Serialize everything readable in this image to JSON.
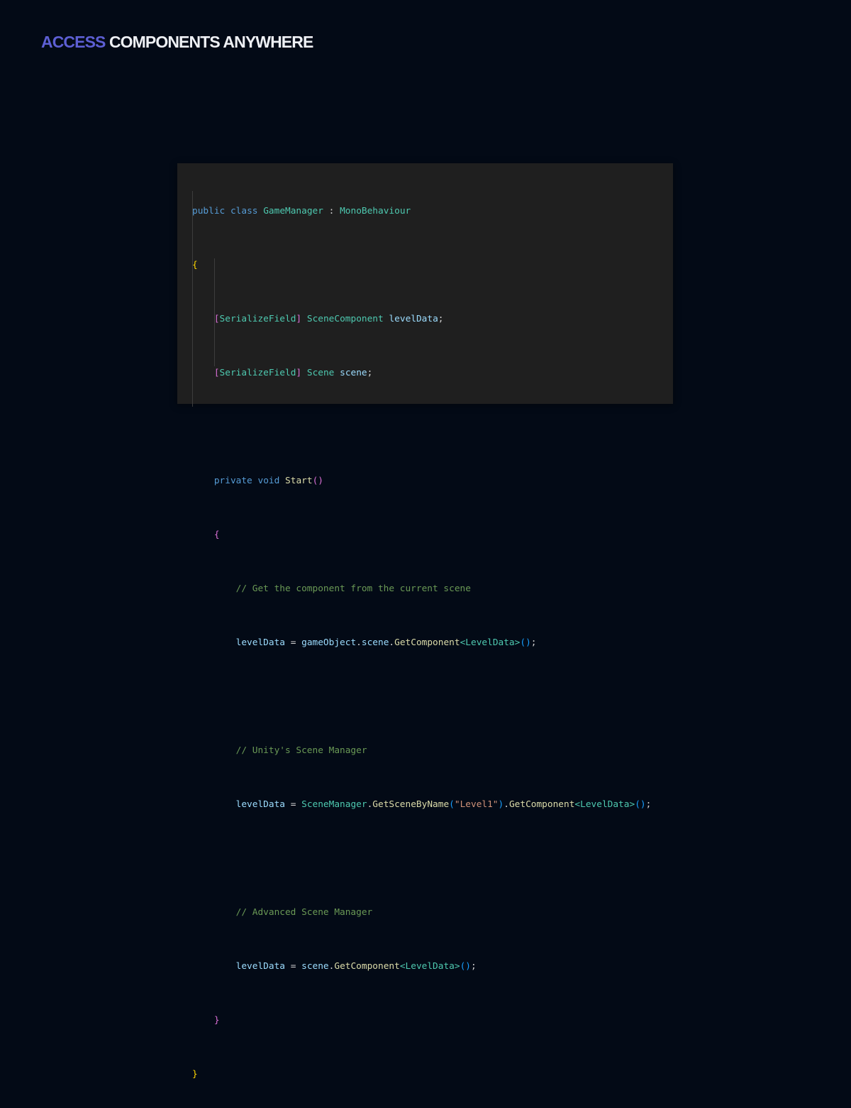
{
  "headline": {
    "accent": "ACCESS",
    "rest": "COMPONENTS ANYWHERE"
  },
  "colors": {
    "background": "#030a16",
    "accent": "#5d5fd3",
    "code_background": "#1f1f1f"
  },
  "code": {
    "language": "csharp",
    "lines": [
      "public class GameManager : MonoBehaviour",
      "{",
      "    [SerializeField] SceneComponent levelData;",
      "    [SerializeField] Scene scene;",
      "",
      "    private void Start()",
      "    {",
      "        // Get the component from the current scene",
      "        levelData = gameObject.scene.GetComponent<LevelData>();",
      "",
      "        // Unity's Scene Manager",
      "        levelData = SceneManager.GetSceneByName(\"Level1\").GetComponent<LevelData>();",
      "",
      "        // Advanced Scene Manager",
      "        levelData = scene.GetComponent<LevelData>();",
      "    }",
      "}"
    ],
    "tokens": {
      "kw_public": "public",
      "kw_class": "class",
      "class_name": "GameManager",
      "colon": " : ",
      "base_class": "MonoBehaviour",
      "brace_open": "{",
      "brace_close": "}",
      "attr_open": "[",
      "attr_name": "SerializeField",
      "attr_close": "]",
      "type_scene_component": "SceneComponent",
      "var_level_data": "levelData",
      "semicolon": ";",
      "type_scene": "Scene",
      "var_scene": "scene",
      "kw_private": "private",
      "kw_void": "void",
      "method_start": "Start",
      "paren_open": "(",
      "paren_close": ")",
      "comment_1": "// Get the component from the current scene",
      "assign": " = ",
      "var_game_object": "gameObject",
      "dot": ".",
      "method_get_component": "GetComponent",
      "angle_open": "<",
      "type_level_data": "LevelData",
      "angle_close": ">",
      "empty_parens": "()",
      "comment_2": "// Unity's Scene Manager",
      "type_scene_manager": "SceneManager",
      "method_get_scene_by_name": "GetSceneByName",
      "string_level1": "\"Level1\"",
      "comment_3": "// Advanced Scene Manager"
    }
  }
}
